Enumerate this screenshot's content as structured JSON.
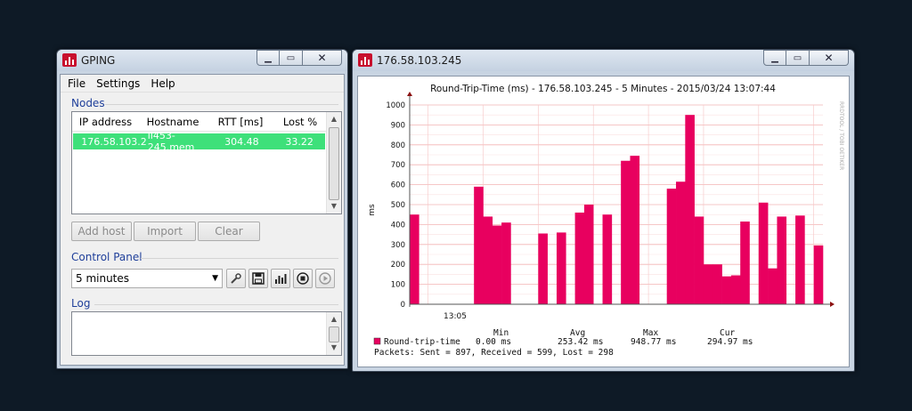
{
  "gping": {
    "title": "GPING",
    "menu": [
      "File",
      "Settings",
      "Help"
    ],
    "nodes_label": "Nodes",
    "columns": [
      "IP address",
      "Hostname",
      "RTT [ms]",
      "Lost %"
    ],
    "rows": [
      {
        "ip": "176.58.103.2",
        "host": "li453-245.mem",
        "rtt": "304.48",
        "lost": "33.22"
      }
    ],
    "buttons": {
      "add": "Add host",
      "import": "Import",
      "clear": "Clear"
    },
    "control_label": "Control Panel",
    "interval": "5 minutes",
    "log_label": "Log"
  },
  "graph_window": {
    "title": "176.58.103.245",
    "side_text": "RRDTOOL / TOBI OETIKER"
  },
  "colors": {
    "accent": "#e8005f",
    "selection": "#3ee07a",
    "grid": "#f3b4b4"
  },
  "chart_data": {
    "type": "bar",
    "title": "Round-Trip-Time (ms) - 176.58.103.245 - 5 Minutes - 2015/03/24  13:07:44",
    "ylabel": "ms",
    "ylim": [
      0,
      1000
    ],
    "yticks": [
      0,
      100,
      200,
      300,
      400,
      500,
      600,
      700,
      800,
      900,
      1000
    ],
    "xtick_label": "13:05",
    "series_name": "Round-trip-time",
    "values": [
      450,
      0,
      0,
      0,
      0,
      0,
      0,
      590,
      440,
      395,
      410,
      0,
      0,
      0,
      355,
      0,
      360,
      0,
      460,
      500,
      0,
      450,
      0,
      720,
      745,
      0,
      0,
      0,
      580,
      615,
      950,
      440,
      200,
      200,
      140,
      145,
      415,
      0,
      510,
      180,
      440,
      0,
      445,
      0,
      295
    ],
    "stats_headers": [
      "Min",
      "Avg",
      "Max",
      "Cur"
    ],
    "stats": {
      "min": "0.00 ms",
      "avg": "253.42 ms",
      "max": "948.77 ms",
      "cur": "294.97 ms"
    },
    "packets": "Packets: Sent = 897, Received = 599, Lost = 298"
  }
}
